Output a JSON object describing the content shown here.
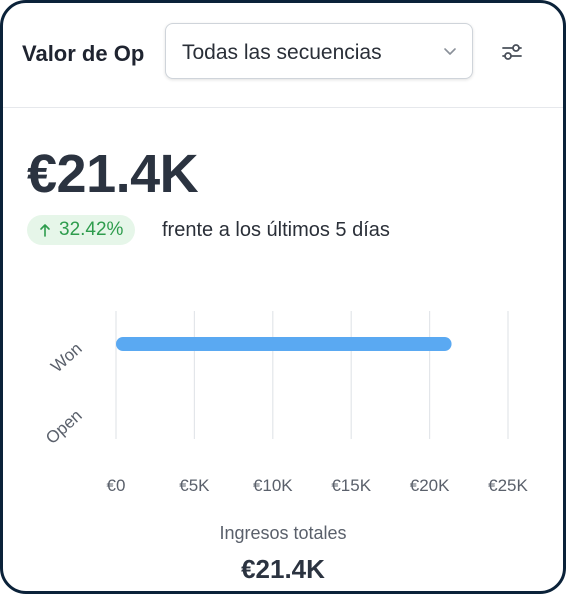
{
  "header": {
    "title": "Valor de Op",
    "sequence_select": {
      "value": "Todas las secuencias",
      "icon": "chevron-down-icon"
    },
    "settings_icon": "sliders-icon"
  },
  "summary": {
    "value": "€21.4K",
    "change": "32.42%",
    "change_direction": "up",
    "comparison_text": "frente a los últimos 5 días"
  },
  "colors": {
    "bar": "#5aa9f2",
    "positive": "#2e9c4d",
    "positive_bg": "#e6f6e9"
  },
  "chart_data": {
    "type": "bar",
    "orientation": "horizontal",
    "categories": [
      "Won",
      "Open"
    ],
    "values": [
      21400,
      0
    ],
    "x_ticks": [
      {
        "value": 0,
        "label": "€0"
      },
      {
        "value": 5000,
        "label": "€5K"
      },
      {
        "value": 10000,
        "label": "€10K"
      },
      {
        "value": 15000,
        "label": "€15K"
      },
      {
        "value": 20000,
        "label": "€20K"
      },
      {
        "value": 25000,
        "label": "€25K"
      }
    ],
    "xlim": [
      0,
      25000
    ],
    "grid": true,
    "legend": "none"
  },
  "footer": {
    "label": "Ingresos totales",
    "value": "€21.4K"
  }
}
